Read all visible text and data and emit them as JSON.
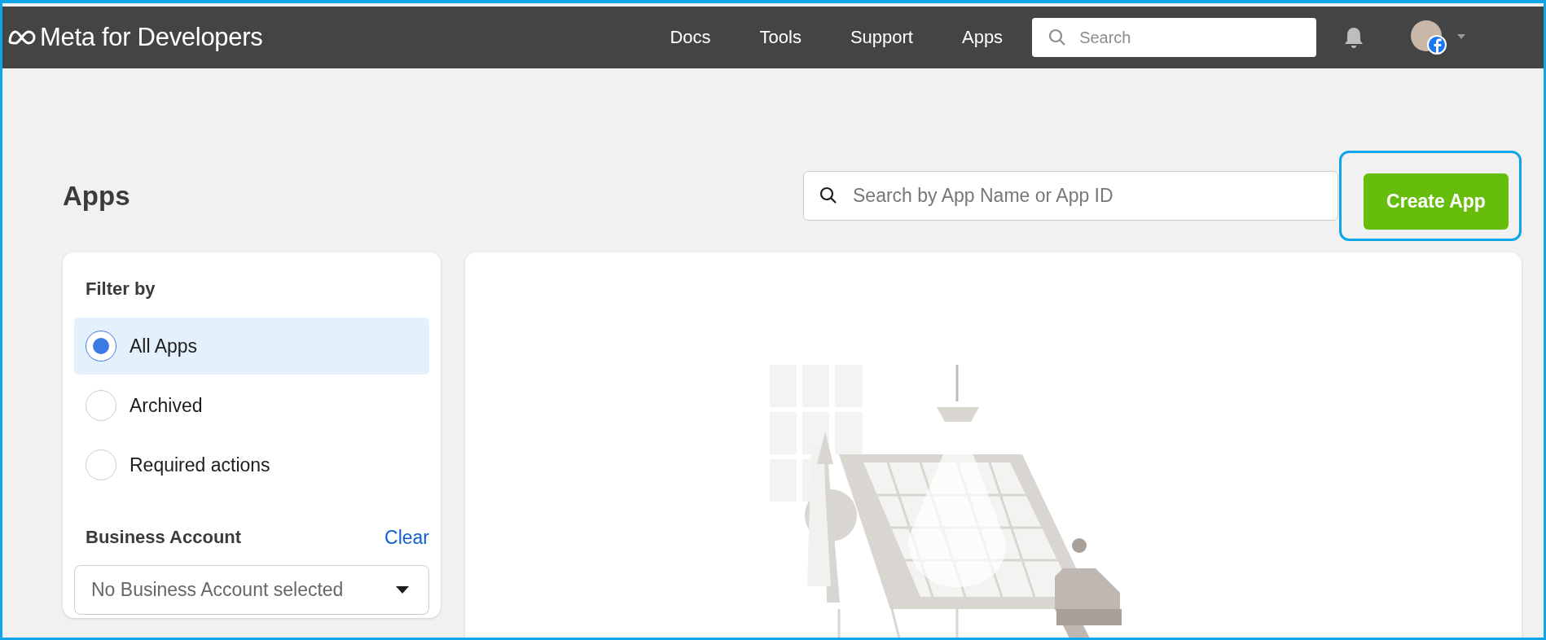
{
  "header": {
    "logo": "Meta for Developers",
    "nav": [
      {
        "label": "Docs"
      },
      {
        "label": "Tools"
      },
      {
        "label": "Support"
      },
      {
        "label": "Apps"
      }
    ],
    "search": {
      "placeholder": "Search"
    }
  },
  "page": {
    "title": "Apps",
    "search": {
      "placeholder": "Search by App Name or App ID"
    },
    "create_button": {
      "label": "Create App",
      "focused": true
    }
  },
  "filter": {
    "title": "Filter by",
    "options": [
      {
        "label": "All Apps",
        "selected": true
      },
      {
        "label": "Archived",
        "selected": false
      },
      {
        "label": "Required actions",
        "selected": false
      }
    ],
    "business_account": {
      "label": "Business Account",
      "clear": "Clear",
      "select": {
        "placeholder": "No Business Account selected"
      }
    }
  }
}
